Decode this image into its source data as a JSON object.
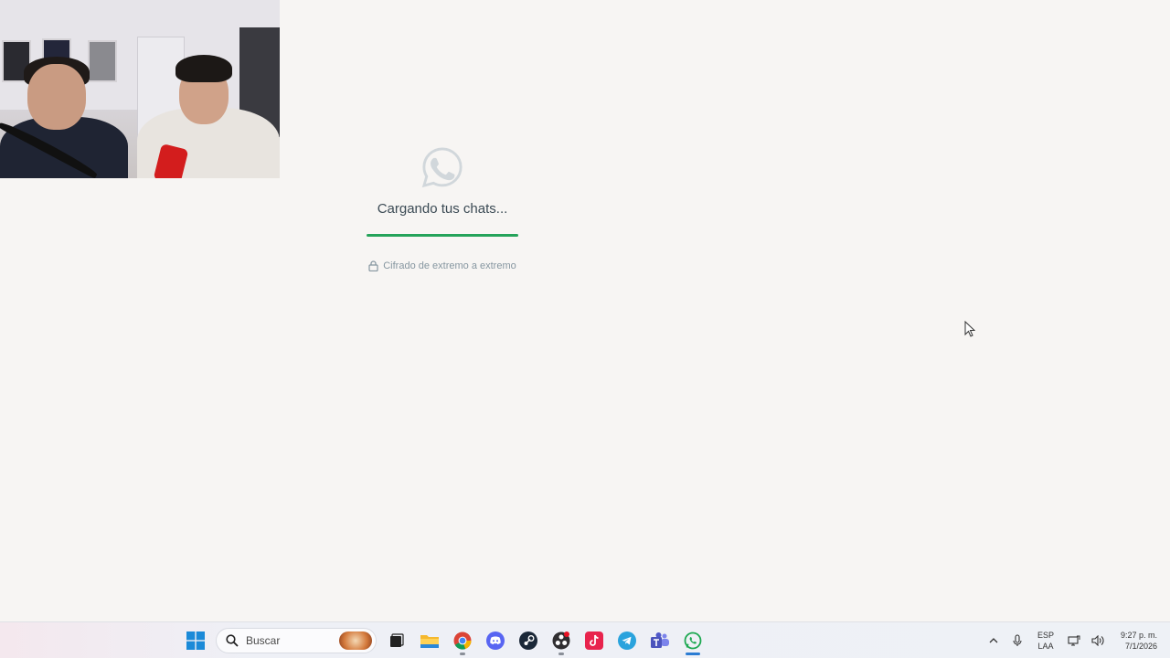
{
  "loading": {
    "text": "Cargando tus chats...",
    "progress_percent": 100,
    "encryption_text": "Cifrado de extremo a extremo"
  },
  "colors": {
    "background": "#f7f5f3",
    "progress": "#25a35a",
    "logo": "#d1d7db"
  },
  "taskbar": {
    "search_placeholder": "Buscar",
    "apps": [
      "windows-start-icon",
      "task-view-icon",
      "file-explorer-icon",
      "chrome-icon",
      "discord-icon",
      "steam-icon",
      "obs-icon",
      "tiktok-icon",
      "telegram-icon",
      "teams-icon",
      "whatsapp-icon"
    ],
    "language_line1": "ESP",
    "language_line2": "LAA",
    "time": "9:27 p. m.",
    "date": "7/1/2026"
  }
}
